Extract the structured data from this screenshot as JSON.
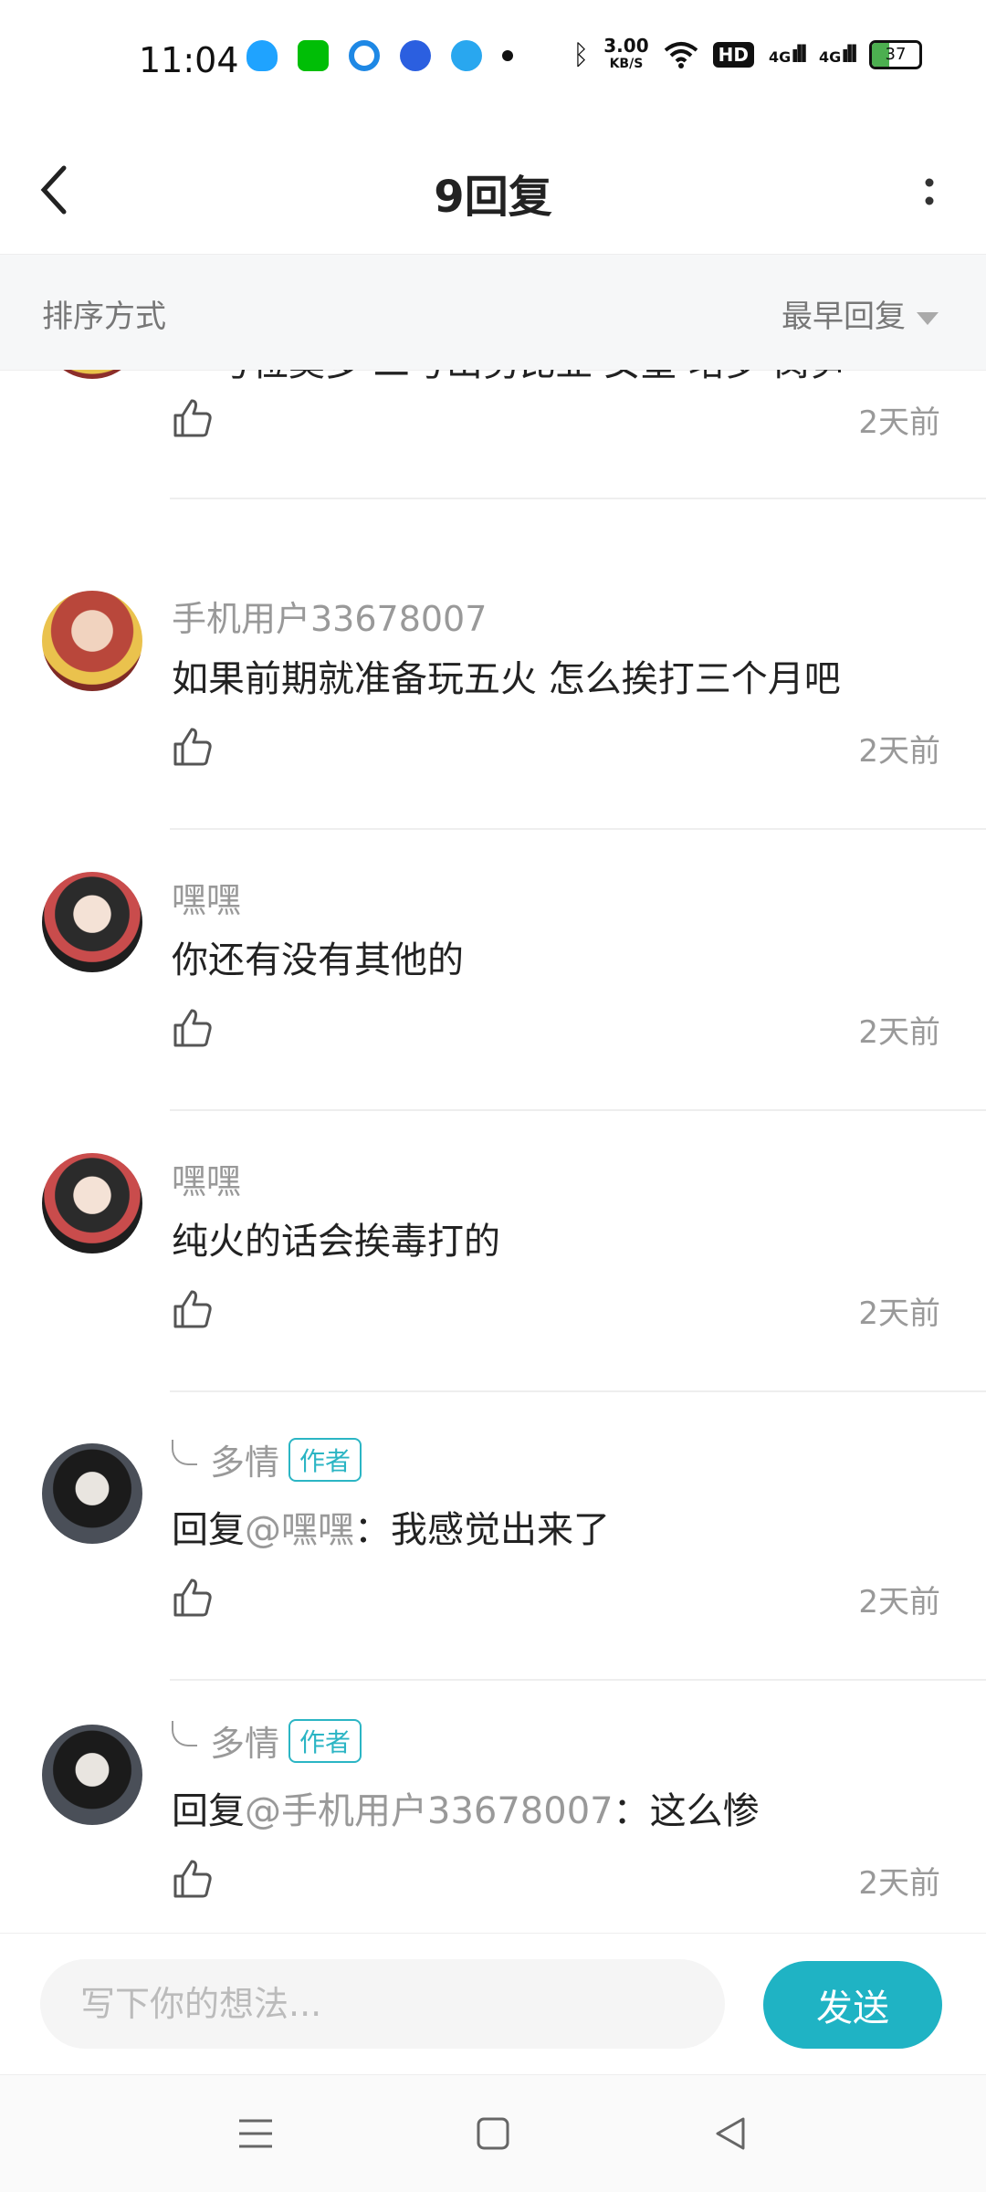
{
  "status_bar": {
    "time": "11:04",
    "net_speed_value": "3.00",
    "net_speed_unit": "KB/S",
    "hd_label": "HD",
    "signal_1": "4G",
    "signal_2": "4G",
    "battery_level": "37"
  },
  "header": {
    "title": "9回复"
  },
  "sort": {
    "label": "排序方式",
    "selected": "最早回复"
  },
  "comments": [
    {
      "username": "",
      "content": "一号位莫多 二号山努比亚 女皇 培罗 莴笋",
      "time": "2天前",
      "author_badge": false
    },
    {
      "username": "手机用户33678007",
      "content": "如果前期就准备玩五火 怎么挨打三个月吧",
      "time": "2天前",
      "author_badge": false
    },
    {
      "username": "嘿嘿",
      "content": "你还有没有其他的",
      "time": "2天前",
      "author_badge": false
    },
    {
      "username": "嘿嘿",
      "content": "纯火的话会挨毒打的",
      "time": "2天前",
      "author_badge": false
    },
    {
      "username": "多情",
      "badge": "作者",
      "reply_prefix": "回复",
      "mention": "@嘿嘿",
      "content": "：我感觉出来了",
      "time": "2天前",
      "author_badge": true
    },
    {
      "username": "多情",
      "badge": "作者",
      "reply_prefix": "回复",
      "mention": "@手机用户33678007",
      "content": "：这么惨",
      "time": "2天前",
      "author_badge": true
    }
  ],
  "input": {
    "placeholder": "写下你的想法...",
    "send_label": "发送"
  },
  "colors": {
    "accent": "#1fb3c4",
    "muted_text": "#999999"
  }
}
